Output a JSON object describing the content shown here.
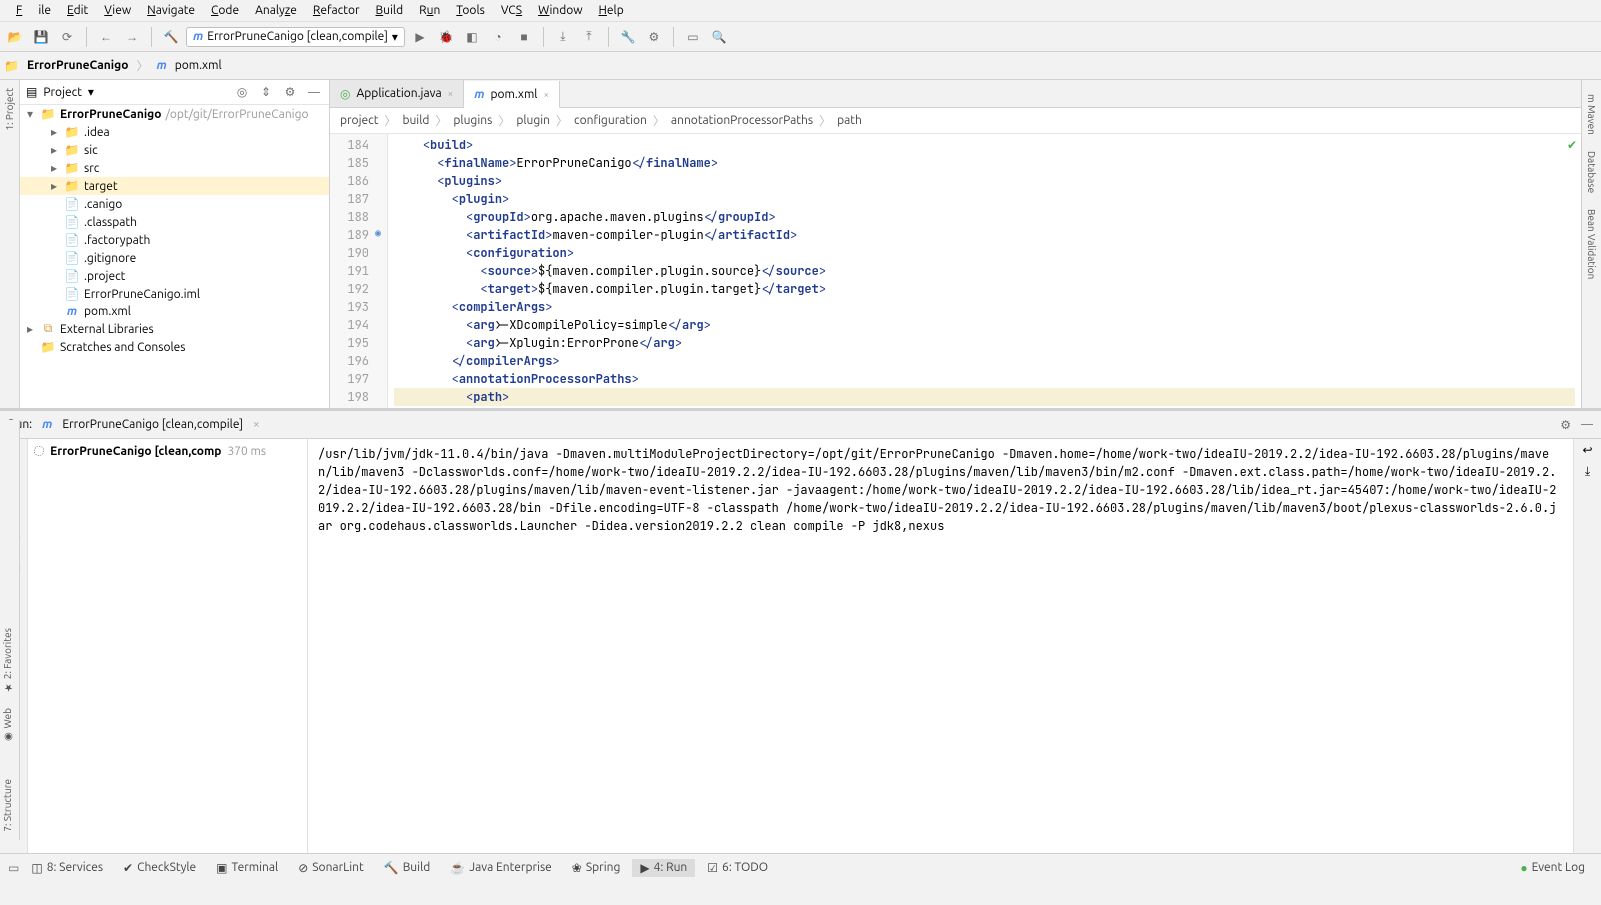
{
  "menu": {
    "file": "File",
    "edit": "Edit",
    "view": "View",
    "navigate": "Navigate",
    "code": "Code",
    "analyze": "Analyze",
    "refactor": "Refactor",
    "build": "Build",
    "run": "Run",
    "tools": "Tools",
    "vcs": "VCS",
    "window": "Window",
    "help": "Help"
  },
  "run_config": {
    "label": "ErrorPruneCanigo [clean,compile]"
  },
  "nav": {
    "root": "ErrorPruneCanigo",
    "file": "pom.xml"
  },
  "project_panel": {
    "title": "Project",
    "root": {
      "name": "ErrorPruneCanigo",
      "path": "/opt/git/ErrorPruneCanigo"
    },
    "items": [
      {
        "name": ".idea",
        "icon": "folder"
      },
      {
        "name": "sic",
        "icon": "folder"
      },
      {
        "name": "src",
        "icon": "folder-blue"
      },
      {
        "name": "target",
        "icon": "folder-orange",
        "selected": true
      },
      {
        "name": ".canigo",
        "icon": "file"
      },
      {
        "name": ".classpath",
        "icon": "file"
      },
      {
        "name": ".factorypath",
        "icon": "file"
      },
      {
        "name": ".gitignore",
        "icon": "file"
      },
      {
        "name": ".project",
        "icon": "file"
      },
      {
        "name": "ErrorPruneCanigo.iml",
        "icon": "file"
      },
      {
        "name": "pom.xml",
        "icon": "maven"
      }
    ],
    "external": "External Libraries",
    "scratches": "Scratches and Consoles"
  },
  "editor": {
    "tabs": [
      {
        "label": "Application.java",
        "active": false
      },
      {
        "label": "pom.xml",
        "active": true
      }
    ],
    "breadcrumb": [
      "project",
      "build",
      "plugins",
      "plugin",
      "configuration",
      "annotationProcessorPaths",
      "path"
    ],
    "line_start": 184,
    "lines": [
      {
        "n": 184,
        "indent": 2,
        "open": "build",
        "close": null,
        "text": null
      },
      {
        "n": 185,
        "indent": 3,
        "open": "finalName",
        "close": "finalName",
        "text": "ErrorPruneCanigo"
      },
      {
        "n": 186,
        "indent": 3,
        "open": "plugins",
        "close": null,
        "text": null
      },
      {
        "n": 187,
        "indent": 4,
        "open": "plugin",
        "close": null,
        "text": null
      },
      {
        "n": 188,
        "indent": 5,
        "open": "groupId",
        "close": "groupId",
        "text": "org.apache.maven.plugins"
      },
      {
        "n": 189,
        "indent": 5,
        "open": "artifactId",
        "close": "artifactId",
        "text": "maven-compiler-plugin",
        "gutter": "config"
      },
      {
        "n": 190,
        "indent": 5,
        "open": "configuration",
        "close": null,
        "text": null
      },
      {
        "n": 191,
        "indent": 6,
        "open": "source",
        "close": "source",
        "text": "${maven.compiler.plugin.source}"
      },
      {
        "n": 192,
        "indent": 6,
        "open": "target",
        "close": "target",
        "text": "${maven.compiler.plugin.target}"
      },
      {
        "n": 193,
        "indent": 4,
        "open": "compilerArgs",
        "close": null,
        "text": null
      },
      {
        "n": 194,
        "indent": 5,
        "open": "arg",
        "close": "arg",
        "text": "-XDcompilePolicy=simple"
      },
      {
        "n": 195,
        "indent": 5,
        "open": "arg",
        "close": "arg",
        "text": "-Xplugin:ErrorProne"
      },
      {
        "n": 196,
        "indent": 4,
        "open": null,
        "close": "compilerArgs",
        "text": null
      },
      {
        "n": 197,
        "indent": 4,
        "open": "annotationProcessorPaths",
        "close": null,
        "text": null
      },
      {
        "n": 198,
        "indent": 5,
        "open": "path",
        "close": null,
        "text": null,
        "highlight": true
      }
    ]
  },
  "left_tabs": {
    "project": "1: Project",
    "favorites": "2: Favorites",
    "structure": "7: Structure",
    "web": "Web"
  },
  "right_tabs": {
    "maven": "Maven",
    "database": "Database",
    "bean": "Bean Validation"
  },
  "run": {
    "header_label": "Run:",
    "header_config": "ErrorPruneCanigo [clean,compile]",
    "tree_item": "ErrorPruneCanigo [clean,comp",
    "tree_time": "370 ms",
    "console": "/usr/lib/jvm/jdk-11.0.4/bin/java -Dmaven.multiModuleProjectDirectory=/opt/git/ErrorPruneCanigo -Dmaven.home=/home/work-two/ideaIU-2019.2.2/idea-IU-192.6603.28/plugins/maven/lib/maven3 -Dclassworlds.conf=/home/work-two/ideaIU-2019.2.2/idea-IU-192.6603.28/plugins/maven/lib/maven3/bin/m2.conf -Dmaven.ext.class.path=/home/work-two/ideaIU-2019.2.2/idea-IU-192.6603.28/plugins/maven/lib/maven-event-listener.jar -javaagent:/home/work-two/ideaIU-2019.2.2/idea-IU-192.6603.28/lib/idea_rt.jar=45407:/home/work-two/ideaIU-2019.2.2/idea-IU-192.6603.28/bin -Dfile.encoding=UTF-8 -classpath /home/work-two/ideaIU-2019.2.2/idea-IU-192.6603.28/plugins/maven/lib/maven3/boot/plexus-classworlds-2.6.0.jar org.codehaus.classworlds.Launcher -Didea.version2019.2.2 clean compile -P jdk8,nexus"
  },
  "statusbar": {
    "items": [
      {
        "label": "8: Services"
      },
      {
        "label": "CheckStyle"
      },
      {
        "label": "Terminal"
      },
      {
        "label": "SonarLint"
      },
      {
        "label": "Build"
      },
      {
        "label": "Java Enterprise"
      },
      {
        "label": "Spring"
      },
      {
        "label": "4: Run",
        "active": true
      },
      {
        "label": "6: TODO"
      }
    ],
    "event_log": "Event Log"
  }
}
